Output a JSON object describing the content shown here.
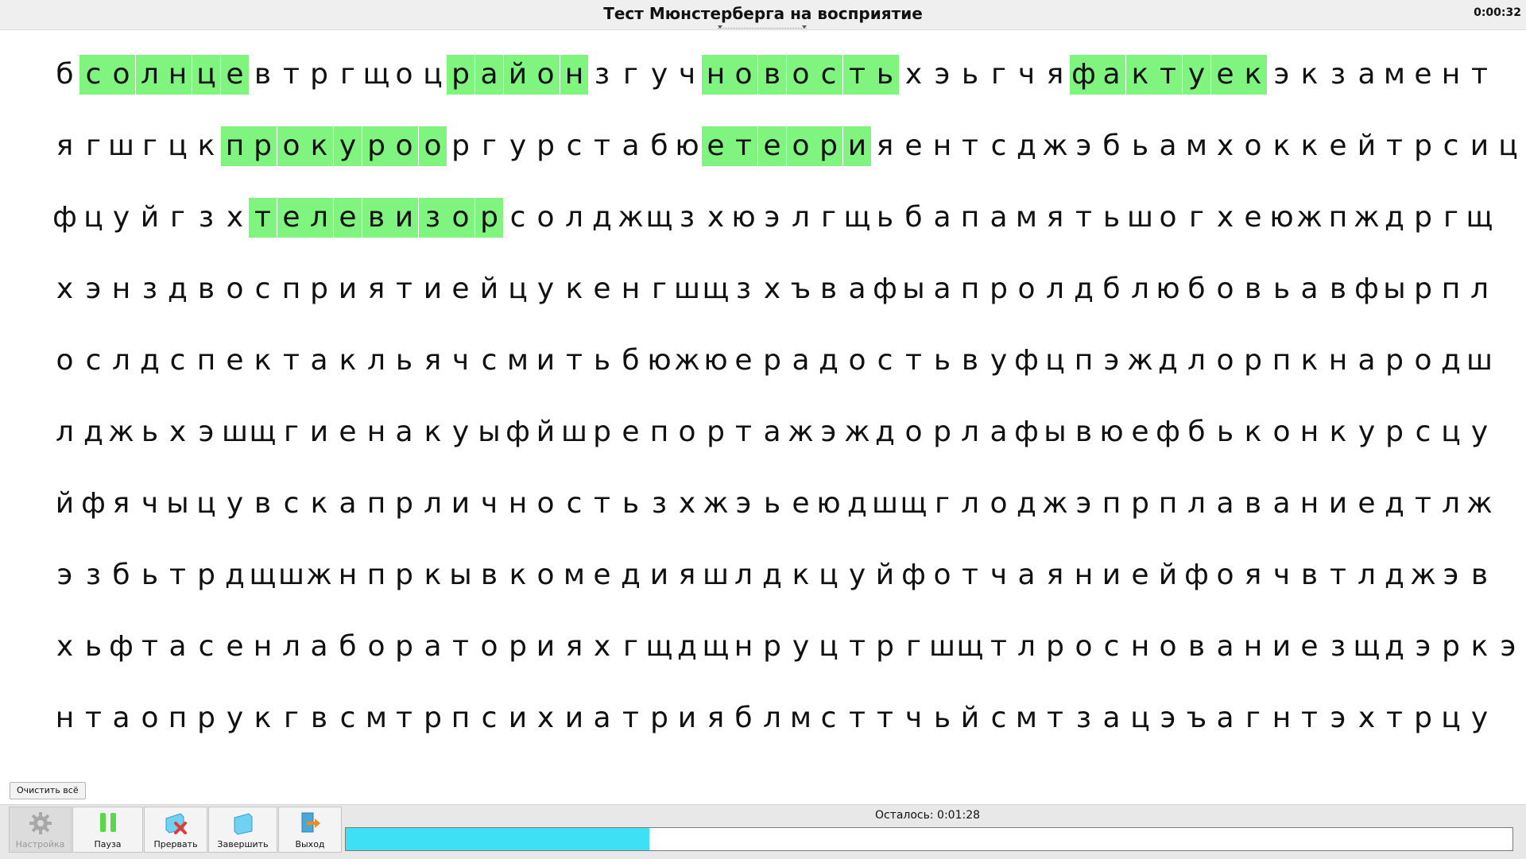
{
  "window": {
    "title": "Тест Мюнстерберга на восприятие",
    "timer": "0:00:32"
  },
  "grid": {
    "rows": [
      "бсолнцевтргщоцрайонзгучновостьхэьгчяфактуекэкзамент",
      "ягшгцкпрокурооргурстабюетеорияентсджэбьамхоккейтрсиц",
      "фцуйгзхтелевизорсолджщзхюэлгщьбапамятьшогхеюжпждргщ",
      "хэнздвосприятиейцукенгшщзхъвафыапролдблюбовьавфырпл",
      "ослдспектакльячсмитьбюжюерадостьвуфцпэждлорпкнародш",
      "лджьхэшщгиенакуыфйшрепортажэждорлафывюефбьконкурсцу",
      "йфячыцувскапрличностьзхжэьеюдшщглоджэпрплаваниедтлж",
      "эзбьтрдщшжнпркывкомедияшлдкцуйфотчаяниейфоячвтлджэв",
      "хьфтасенлабораторияхгщдщнруцтргшщтлроснованиезщдэркэ",
      "нтаопрукгвсмтрпсихиатрияблмсттчьйсмтзацэъагнтэхтрцу"
    ],
    "selections": [
      {
        "row": 0,
        "start": 1,
        "end": 6
      },
      {
        "row": 0,
        "start": 14,
        "end": 18
      },
      {
        "row": 0,
        "start": 23,
        "end": 29
      },
      {
        "row": 0,
        "start": 36,
        "end": 42
      },
      {
        "row": 1,
        "start": 6,
        "end": 13
      },
      {
        "row": 1,
        "start": 23,
        "end": 28
      },
      {
        "row": 2,
        "start": 7,
        "end": 15
      }
    ],
    "selected_color": "#7ff57f"
  },
  "buttons": {
    "clear_all": "Очистить всё",
    "settings": "Настройка",
    "pause": "Пауза",
    "interrupt": "Прервать",
    "finish": "Завершить",
    "exit": "Выход"
  },
  "status": {
    "remaining": "Осталось: 0:01:28",
    "progress": 0.26,
    "progress_color": "#3ee0f5"
  }
}
